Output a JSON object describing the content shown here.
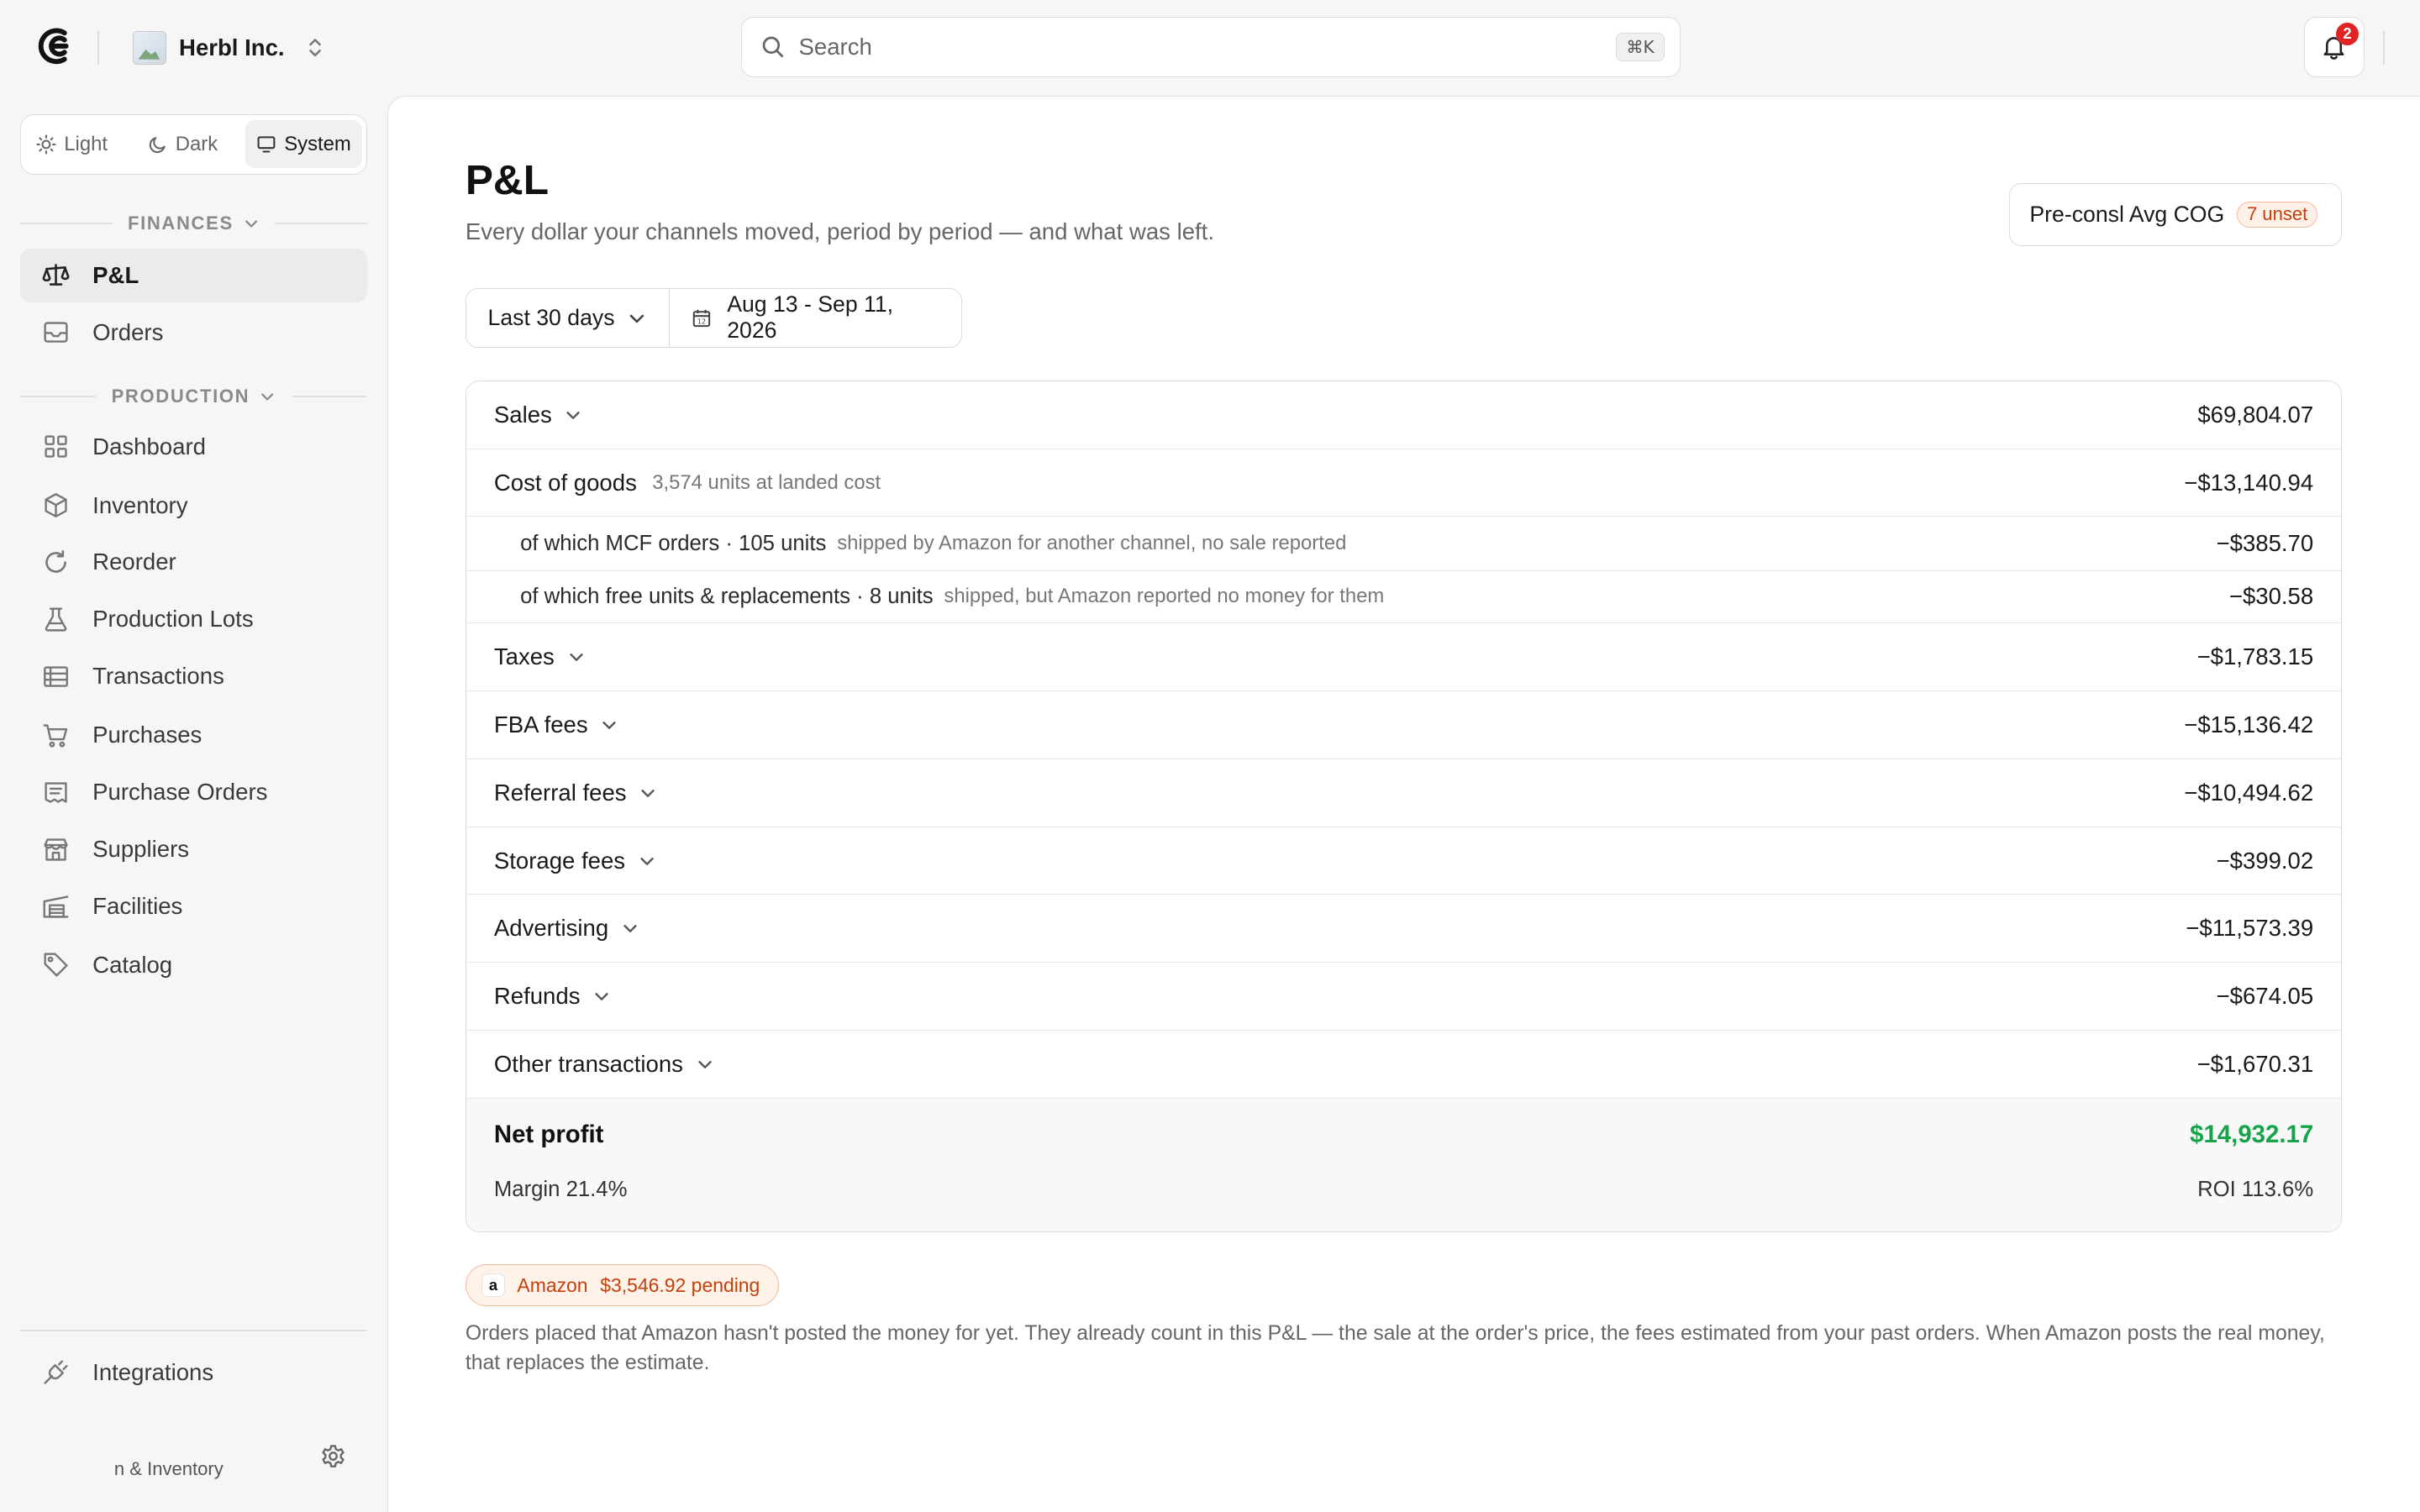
{
  "org": {
    "name": "Herbl Inc."
  },
  "search": {
    "placeholder": "Search",
    "shortcut": "⌘K"
  },
  "notifications": {
    "count": "2"
  },
  "theme": {
    "options": [
      "Light",
      "Dark",
      "System"
    ],
    "selected": "System"
  },
  "sidebar": {
    "sections": [
      {
        "label": "FINANCES",
        "items": [
          {
            "label": "P&L",
            "icon": "scale-icon",
            "active": true
          },
          {
            "label": "Orders",
            "icon": "inbox-icon"
          }
        ]
      },
      {
        "label": "PRODUCTION",
        "items": [
          {
            "label": "Dashboard",
            "icon": "grid-icon"
          },
          {
            "label": "Inventory",
            "icon": "box-icon"
          },
          {
            "label": "Reorder",
            "icon": "refresh-icon"
          },
          {
            "label": "Production Lots",
            "icon": "flask-icon"
          },
          {
            "label": "Transactions",
            "icon": "ledger-icon"
          },
          {
            "label": "Purchases",
            "icon": "cart-icon"
          },
          {
            "label": "Purchase Orders",
            "icon": "receipt-icon"
          },
          {
            "label": "Suppliers",
            "icon": "store-icon"
          },
          {
            "label": "Facilities",
            "icon": "warehouse-icon"
          },
          {
            "label": "Catalog",
            "icon": "tag-icon"
          }
        ]
      }
    ],
    "integrations": "Integrations",
    "footer_text": "n & Inventory"
  },
  "page": {
    "title": "P&L",
    "subtitle": "Every dollar your channels moved, period by period — and what was left.",
    "cog_button": "Pre-consl Avg COG",
    "cog_badge": "7 unset",
    "range": "Last 30 days",
    "dates": "Aug 13 - Sep 11, 2026"
  },
  "pl": {
    "rows": [
      {
        "label": "Sales",
        "value": "$69,804.07",
        "expandable": true
      },
      {
        "label": "Cost of goods",
        "note": "3,574 units at landed cost",
        "value": "−$13,140.94"
      },
      {
        "label": "of which MCF orders · 105 units",
        "note": "shipped by Amazon for another channel, no sale reported",
        "value": "−$385.70",
        "sub": true
      },
      {
        "label": "of which free units & replacements · 8 units",
        "note": "shipped, but Amazon reported no money for them",
        "value": "−$30.58",
        "sub": true
      },
      {
        "label": "Taxes",
        "value": "−$1,783.15",
        "expandable": true
      },
      {
        "label": "FBA fees",
        "value": "−$15,136.42",
        "expandable": true
      },
      {
        "label": "Referral fees",
        "value": "−$10,494.62",
        "expandable": true
      },
      {
        "label": "Storage fees",
        "value": "−$399.02",
        "expandable": true
      },
      {
        "label": "Advertising",
        "value": "−$11,573.39",
        "expandable": true
      },
      {
        "label": "Refunds",
        "value": "−$674.05",
        "expandable": true
      },
      {
        "label": "Other transactions",
        "value": "−$1,670.31",
        "expandable": true
      }
    ],
    "net_label": "Net profit",
    "net_value": "$14,932.17",
    "margin": "Margin 21.4%",
    "roi": "ROI 113.6%"
  },
  "pending": {
    "mark": "a",
    "channel": "Amazon",
    "amount": "$3,546.92 pending",
    "note": "Orders placed that Amazon hasn't posted the money for yet. They already count in this P&L — the sale at the order's price, the fees estimated from your past orders. When Amazon posts the real money, that replaces the estimate."
  },
  "colors": {
    "positive": "#16a34a",
    "badge": "#c2410c",
    "notification": "#e02424"
  }
}
